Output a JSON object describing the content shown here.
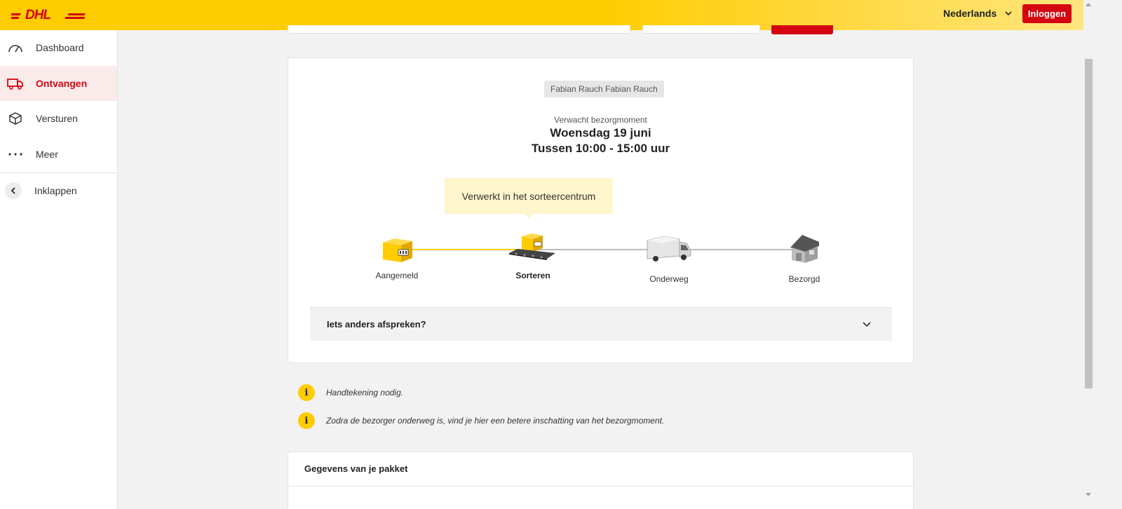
{
  "header": {
    "logo_text": "DHL",
    "language": "Nederlands",
    "login_label": "Inloggen",
    "brand_yellow": "#ffcc00",
    "brand_red": "#d40511"
  },
  "sidebar": {
    "items": [
      {
        "label": "Dashboard",
        "icon": "gauge-icon"
      },
      {
        "label": "Ontvangen",
        "icon": "truck-icon",
        "active": true
      },
      {
        "label": "Versturen",
        "icon": "package-icon"
      },
      {
        "label": "Meer",
        "icon": "more-dots-icon"
      }
    ],
    "collapse_label": "Inklappen"
  },
  "shipment": {
    "recipient_name": "Fabian Rauch Fabian Rauch",
    "expected_label": "Verwacht bezorgmoment",
    "expected_day": "Woensdag 19 juni",
    "expected_time": "Tussen 10:00 - 15:00 uur",
    "status_tooltip": "Verwerkt in het sorteercentrum",
    "steps": [
      {
        "label": "Aangemeld",
        "icon": "box-icon",
        "done": true
      },
      {
        "label": "Sorteren",
        "icon": "conveyor-box-icon",
        "current": true
      },
      {
        "label": "Onderweg",
        "icon": "delivery-van-icon"
      },
      {
        "label": "Bezorgd",
        "icon": "house-icon"
      }
    ],
    "accordion_title": "Iets anders afspreken?"
  },
  "notices": [
    "Handtekening nodig.",
    "Zodra de bezorger onderweg is, vind je hier een betere inschatting van het bezorgmoment."
  ],
  "details": {
    "title": "Gegevens van je pakket"
  }
}
